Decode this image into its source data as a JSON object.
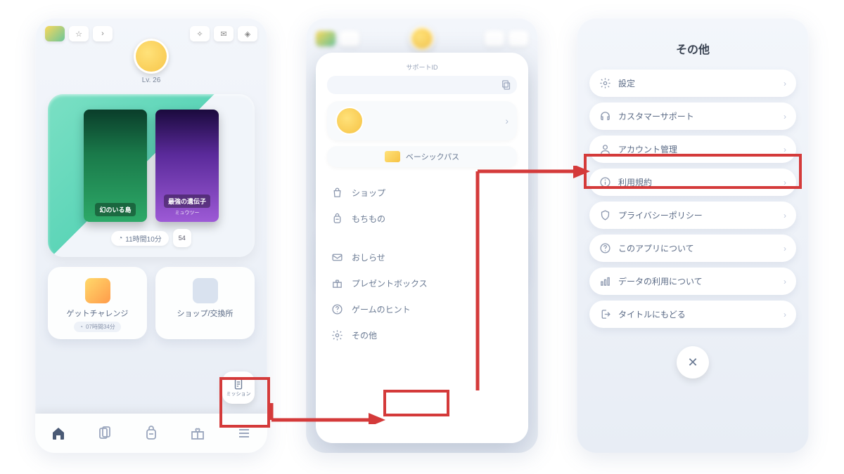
{
  "phone1": {
    "level": "Lv. 26",
    "packs": [
      {
        "title": "幻のいる島",
        "sub": ""
      },
      {
        "title": "最強の遺伝子",
        "sub": "ミュウツー"
      }
    ],
    "timer": "11時間10分",
    "gem_count": "54",
    "buttons": {
      "challenge": "ゲットチャレンジ",
      "challenge_timer": "07時間34分",
      "shop": "ショップ/交換所"
    },
    "mission": "ミッション"
  },
  "phone2": {
    "support_label": "サポートID",
    "pass": "ベーシックパス",
    "group1": [
      {
        "icon": "bag",
        "label": "ショップ"
      },
      {
        "icon": "backpack",
        "label": "もちもの"
      }
    ],
    "group2": [
      {
        "icon": "mail",
        "label": "おしらせ"
      },
      {
        "icon": "gift",
        "label": "プレゼントボックス"
      },
      {
        "icon": "help",
        "label": "ゲームのヒント"
      },
      {
        "icon": "gear",
        "label": "その他"
      }
    ]
  },
  "phone3": {
    "title": "その他",
    "items": [
      {
        "icon": "gear",
        "label": "設定"
      },
      {
        "icon": "headset",
        "label": "カスタマーサポート"
      },
      {
        "icon": "user",
        "label": "アカウント管理"
      },
      {
        "icon": "info",
        "label": "利用規約"
      },
      {
        "icon": "shield",
        "label": "プライバシーポリシー"
      },
      {
        "icon": "help",
        "label": "このアプリについて"
      },
      {
        "icon": "chart",
        "label": "データの利用について"
      },
      {
        "icon": "logout",
        "label": "タイトルにもどる"
      }
    ]
  }
}
